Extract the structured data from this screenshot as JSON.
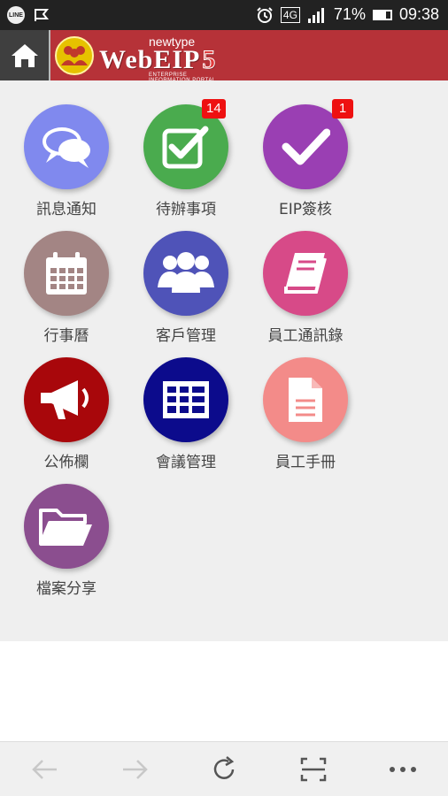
{
  "status_bar": {
    "left_icons": [
      "line-icon",
      "notification-flag-icon"
    ],
    "line_text": "LINE",
    "network": "4G",
    "battery_text": "71%",
    "battery_level": 0.71,
    "time": "09:38"
  },
  "header": {
    "home_icon": "home-icon",
    "logo_small": "newtype",
    "logo_main": "WebEIP",
    "logo_version": "5",
    "logo_sub": "ENTERPRISE INFORMATION PORTAL"
  },
  "tiles": [
    {
      "label": "訊息通知",
      "icon": "chat-bubbles-icon",
      "color": "#8089ee",
      "badge": ""
    },
    {
      "label": "待辦事項",
      "icon": "checkbox-icon",
      "color": "#4aab4e",
      "badge": "14"
    },
    {
      "label": "EIP簽核",
      "icon": "checkmark-icon",
      "color": "#9a3fb3",
      "badge": "1"
    },
    {
      "label": "行事曆",
      "icon": "calendar-icon",
      "color": "#a38584",
      "badge": ""
    },
    {
      "label": "客戶管理",
      "icon": "group-icon",
      "color": "#4f53b8",
      "badge": ""
    },
    {
      "label": "員工通訊錄",
      "icon": "book-icon",
      "color": "#d74a88",
      "badge": ""
    },
    {
      "label": "公佈欄",
      "icon": "megaphone-icon",
      "color": "#a8070b",
      "badge": ""
    },
    {
      "label": "會議管理",
      "icon": "grid-table-icon",
      "color": "#0c0b8c",
      "badge": ""
    },
    {
      "label": "員工手冊",
      "icon": "document-icon",
      "color": "#f38b89",
      "badge": ""
    },
    {
      "label": "檔案分享",
      "icon": "folder-icon",
      "color": "#8b4e8f",
      "badge": ""
    }
  ],
  "bottom_nav": [
    "back-arrow-icon",
    "forward-arrow-icon",
    "reload-icon",
    "scan-icon",
    "more-icon"
  ]
}
